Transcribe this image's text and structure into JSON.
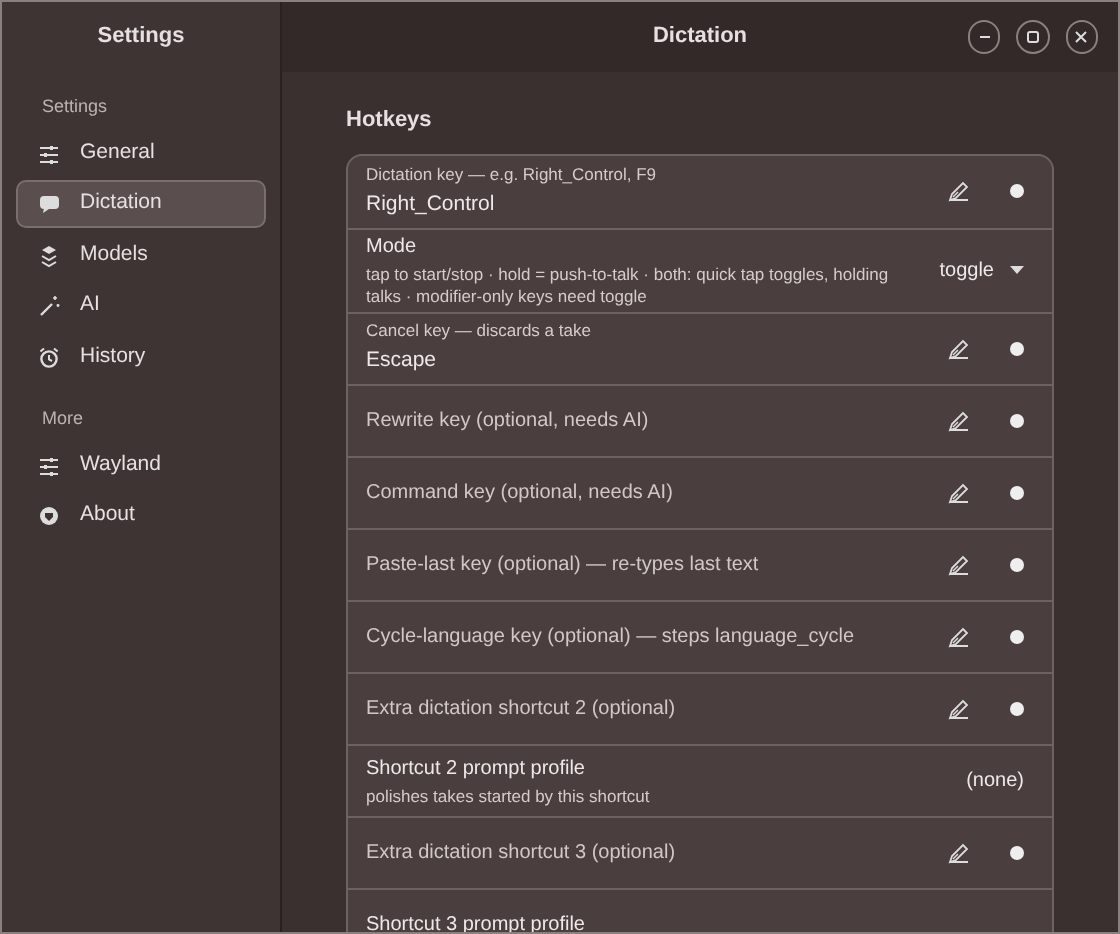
{
  "sidebar": {
    "title": "Settings",
    "sections": [
      {
        "heading": "Settings",
        "items": [
          {
            "label": "General",
            "selected": false
          },
          {
            "label": "Dictation",
            "selected": true
          },
          {
            "label": "Models",
            "selected": false
          },
          {
            "label": "AI",
            "selected": false
          },
          {
            "label": "History",
            "selected": false
          }
        ]
      },
      {
        "heading": "More",
        "items": [
          {
            "label": "Wayland",
            "selected": false
          },
          {
            "label": "About",
            "selected": false
          }
        ]
      }
    ]
  },
  "header": {
    "title": "Dictation"
  },
  "section": {
    "title": "Hotkeys"
  },
  "rows": [
    {
      "kind": "key",
      "label": "Dictation key — e.g. Right_Control, F9",
      "value": "Right_Control"
    },
    {
      "kind": "select",
      "label": "Mode",
      "description": "tap to start/stop · hold = push-to-talk · both: quick tap toggles, holding talks · modifier-only keys need toggle",
      "value": "toggle"
    },
    {
      "kind": "key",
      "label": "Cancel key — discards a take",
      "value": "Escape"
    },
    {
      "kind": "key",
      "label": "Rewrite key (optional, needs AI)"
    },
    {
      "kind": "key",
      "label": "Command key (optional, needs AI)"
    },
    {
      "kind": "key",
      "label": "Paste-last key (optional) — re-types last text"
    },
    {
      "kind": "key",
      "label": "Cycle-language key (optional) — steps language_cycle"
    },
    {
      "kind": "key",
      "label": "Extra dictation shortcut 2 (optional)"
    },
    {
      "kind": "choice",
      "label": "Shortcut 2 prompt profile",
      "description": "polishes takes started by this shortcut",
      "value": "(none)"
    },
    {
      "kind": "key",
      "label": "Extra dictation shortcut 3 (optional)"
    },
    {
      "kind": "choice",
      "label": "Shortcut 3 prompt profile"
    }
  ]
}
